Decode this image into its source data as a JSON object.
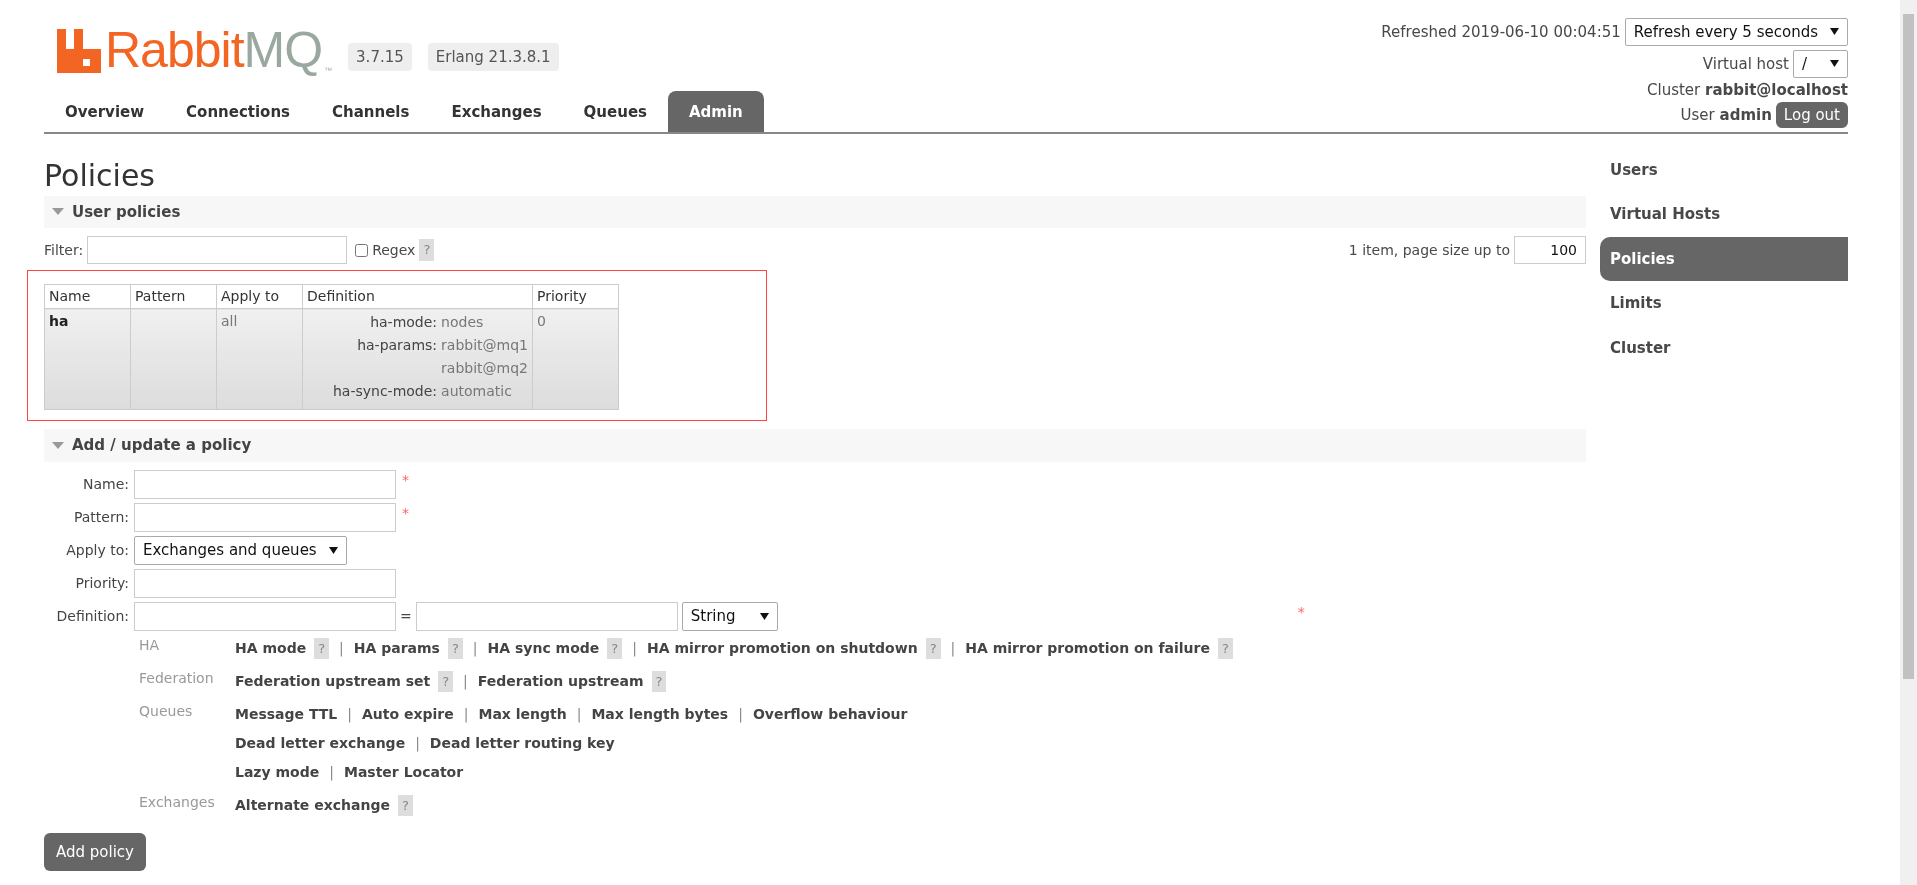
{
  "header": {
    "logo": {
      "primary": "Rabbit",
      "secondary": "MQ",
      "mark": "™"
    },
    "versions": [
      "3.7.15",
      "Erlang 21.3.8.1"
    ],
    "tabs": [
      {
        "label": "Overview",
        "selected": false
      },
      {
        "label": "Connections",
        "selected": false
      },
      {
        "label": "Channels",
        "selected": false
      },
      {
        "label": "Exchanges",
        "selected": false
      },
      {
        "label": "Queues",
        "selected": false
      },
      {
        "label": "Admin",
        "selected": true
      }
    ],
    "refreshed": "Refreshed 2019-06-10 00:04:51",
    "refresh_select": "Refresh every 5 seconds",
    "virtual_host": {
      "label": "Virtual host",
      "value": "/"
    },
    "cluster": {
      "label": "Cluster",
      "value": "rabbit@localhost"
    },
    "user": {
      "label": "User",
      "value": "admin"
    },
    "logout": "Log out"
  },
  "page_title": "Policies",
  "user_policies": {
    "title": "User policies",
    "expanded": true,
    "filter_label": "Filter:",
    "regex": {
      "label": "Regex",
      "checked": false,
      "help": "?"
    },
    "pagination_text": "1 item, page size up to",
    "page_size": "100",
    "highlighted": true,
    "table": {
      "columns": [
        "Name",
        "Pattern",
        "Apply to",
        "Definition",
        "Priority"
      ],
      "rows": [
        {
          "name": "ha",
          "apply_to": "all",
          "priority": "0",
          "definition": [
            {
              "key": "ha-mode:",
              "values": [
                "nodes"
              ]
            },
            {
              "key": "ha-params:",
              "values": [
                "rabbit@mq1",
                "rabbit@mq2"
              ]
            },
            {
              "key": "ha-sync-mode:",
              "values": [
                "automatic"
              ]
            }
          ]
        }
      ]
    }
  },
  "add_policy": {
    "title": "Add / update a policy",
    "expanded": true,
    "required_mark": "*",
    "fields": [
      {
        "label": "Name:",
        "kind": "text",
        "required": true
      },
      {
        "label": "Pattern:",
        "kind": "text",
        "required": true
      },
      {
        "label": "Apply to:",
        "kind": "select",
        "value": "Exchanges and queues",
        "required": false
      },
      {
        "label": "Priority:",
        "kind": "text",
        "required": false
      },
      {
        "label": "Definition:",
        "kind": "pair",
        "separator": "=",
        "type_value": "String",
        "required": true
      }
    ],
    "help_mark": "?",
    "separator": "|",
    "groups": [
      {
        "name": "HA",
        "lines": [
          [
            {
              "label": "HA mode",
              "help": true
            },
            {
              "label": "HA params",
              "help": true
            },
            {
              "label": "HA sync mode",
              "help": true
            },
            {
              "label": "HA mirror promotion on shutdown",
              "help": true
            },
            {
              "label": "HA mirror promotion on failure",
              "help": true
            }
          ]
        ]
      },
      {
        "name": "Federation",
        "lines": [
          [
            {
              "label": "Federation upstream set",
              "help": true
            },
            {
              "label": "Federation upstream",
              "help": true
            }
          ]
        ]
      },
      {
        "name": "Queues",
        "lines": [
          [
            {
              "label": "Message TTL",
              "help": false
            },
            {
              "label": "Auto expire",
              "help": false
            },
            {
              "label": "Max length",
              "help": false
            },
            {
              "label": "Max length bytes",
              "help": false
            },
            {
              "label": "Overflow behaviour",
              "help": false
            }
          ],
          [
            {
              "label": "Dead letter exchange",
              "help": false
            },
            {
              "label": "Dead letter routing key",
              "help": false
            }
          ],
          [
            {
              "label": "Lazy mode",
              "help": false
            },
            {
              "label": "Master Locator",
              "help": false
            }
          ]
        ]
      },
      {
        "name": "Exchanges",
        "lines": [
          [
            {
              "label": "Alternate exchange",
              "help": true
            }
          ]
        ]
      }
    ],
    "submit": "Add policy"
  },
  "sidebar": {
    "items": [
      {
        "label": "Users",
        "selected": false
      },
      {
        "label": "Virtual Hosts",
        "selected": false
      },
      {
        "label": "Policies",
        "selected": true
      },
      {
        "label": "Limits",
        "selected": false
      },
      {
        "label": "Cluster",
        "selected": false
      }
    ]
  }
}
